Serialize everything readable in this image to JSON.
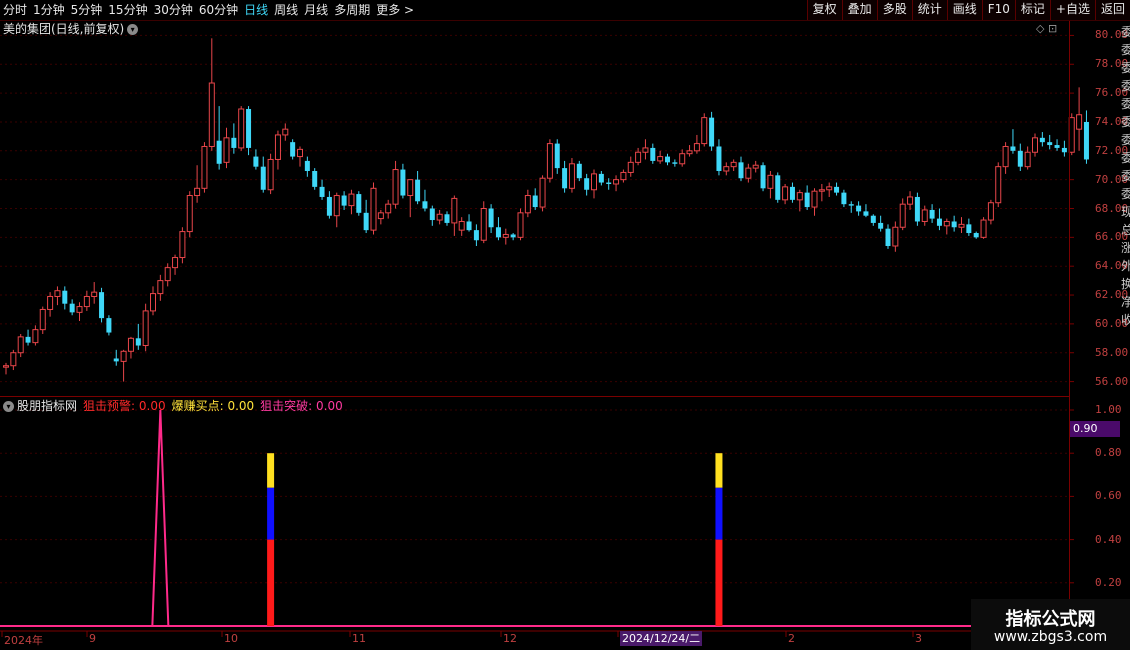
{
  "toolbar": {
    "periods": [
      "分时",
      "1分钟",
      "5分钟",
      "15分钟",
      "30分钟",
      "60分钟",
      "日线",
      "周线",
      "月线",
      "多周期",
      "更多 >"
    ],
    "active_period": "日线",
    "tools": [
      "复权",
      "叠加",
      "多股",
      "统计",
      "画线",
      "F10",
      "标记",
      "+自选",
      "返回"
    ]
  },
  "stock_title": "美的集团(日线,前复权)",
  "corner_icons": "◇ ⊡",
  "price_axis": [
    "80.00",
    "78.00",
    "76.00",
    "74.00",
    "72.00",
    "70.00",
    "68.00",
    "66.00",
    "64.00",
    "62.00",
    "60.00",
    "58.00",
    "56.00"
  ],
  "indicator": {
    "name": "股朋指标网",
    "items": [
      {
        "label": "狙击预警: 0.00",
        "color": "#ff2a2a"
      },
      {
        "label": "爆赚买点: 0.00",
        "color": "#ffe23a"
      },
      {
        "label": "狙击突破: 0.00",
        "color": "#ff3aa0"
      }
    ],
    "axis": [
      "1.00",
      "0.80",
      "0.60",
      "0.40",
      "0.20"
    ],
    "current_value": "0.90"
  },
  "date_labels": [
    "2024年",
    "9",
    "10",
    "11",
    "12",
    "2024/12/24/二",
    "2",
    "3"
  ],
  "right_strip_chars": [
    "委",
    "委",
    "委",
    "委",
    "委",
    "委",
    "委",
    "委",
    "委",
    "委",
    "现",
    "总",
    "涨",
    "外",
    "换",
    "净",
    "收"
  ],
  "watermark": {
    "line1": "指标公式网",
    "line2": "www.zbgs3.com"
  },
  "colors": {
    "up": "#e8464a",
    "down": "#3fd8f8",
    "pink": "#ff2a8a",
    "red_bar": "#ff1a1a",
    "blue_bar": "#1010ff",
    "yellow_bar": "#ffe020"
  },
  "chart_data": {
    "type": "candlestick",
    "ylim": [
      55,
      81
    ],
    "candles": [
      [
        57.0,
        57.3,
        56.5,
        57.1
      ],
      [
        57.1,
        58.2,
        56.8,
        58.0
      ],
      [
        58.0,
        59.3,
        57.7,
        59.1
      ],
      [
        59.1,
        59.6,
        58.5,
        58.7
      ],
      [
        58.7,
        59.9,
        58.5,
        59.6
      ],
      [
        59.6,
        61.2,
        59.3,
        61.0
      ],
      [
        61.0,
        62.2,
        60.5,
        61.9
      ],
      [
        61.9,
        62.6,
        61.3,
        62.3
      ],
      [
        62.3,
        62.6,
        61.0,
        61.4
      ],
      [
        61.4,
        61.7,
        60.6,
        60.8
      ],
      [
        60.8,
        61.5,
        60.2,
        61.2
      ],
      [
        61.2,
        62.3,
        60.9,
        61.9
      ],
      [
        61.9,
        62.9,
        61.4,
        62.2
      ],
      [
        62.2,
        62.5,
        60.1,
        60.4
      ],
      [
        60.4,
        60.6,
        59.2,
        59.4
      ],
      [
        57.6,
        58.2,
        57.1,
        57.4
      ],
      [
        57.4,
        58.2,
        56.0,
        58.1
      ],
      [
        58.1,
        59.1,
        57.6,
        59.0
      ],
      [
        59.0,
        60.0,
        58.2,
        58.5
      ],
      [
        58.5,
        61.4,
        58.1,
        60.9
      ],
      [
        60.9,
        62.6,
        60.6,
        62.1
      ],
      [
        62.1,
        63.4,
        61.6,
        63.0
      ],
      [
        63.0,
        64.2,
        62.6,
        63.9
      ],
      [
        63.9,
        64.8,
        63.4,
        64.6
      ],
      [
        64.6,
        66.7,
        64.2,
        66.4
      ],
      [
        66.4,
        69.2,
        66.0,
        68.9
      ],
      [
        68.9,
        71.0,
        68.4,
        69.4
      ],
      [
        69.4,
        72.6,
        69.1,
        72.3
      ],
      [
        72.3,
        79.8,
        72.0,
        76.7
      ],
      [
        72.7,
        75.1,
        70.7,
        71.1
      ],
      [
        71.2,
        73.6,
        70.8,
        72.9
      ],
      [
        72.9,
        73.9,
        71.8,
        72.2
      ],
      [
        72.2,
        75.1,
        72.0,
        74.9
      ],
      [
        74.9,
        75.1,
        71.7,
        72.2
      ],
      [
        71.6,
        72.1,
        70.7,
        70.9
      ],
      [
        70.9,
        71.6,
        69.1,
        69.3
      ],
      [
        69.3,
        71.8,
        69.0,
        71.4
      ],
      [
        71.4,
        73.4,
        70.7,
        73.1
      ],
      [
        73.1,
        73.9,
        72.7,
        73.5
      ],
      [
        72.6,
        72.8,
        71.4,
        71.6
      ],
      [
        71.6,
        72.3,
        70.9,
        72.1
      ],
      [
        71.3,
        71.6,
        70.2,
        70.6
      ],
      [
        70.6,
        70.8,
        69.3,
        69.5
      ],
      [
        69.5,
        70.0,
        68.6,
        68.8
      ],
      [
        68.8,
        69.2,
        67.3,
        67.5
      ],
      [
        67.5,
        69.1,
        66.7,
        68.9
      ],
      [
        68.9,
        69.2,
        67.9,
        68.2
      ],
      [
        68.2,
        69.3,
        67.6,
        69.0
      ],
      [
        69.0,
        69.2,
        67.5,
        67.7
      ],
      [
        67.7,
        68.6,
        66.3,
        66.5
      ],
      [
        66.5,
        69.8,
        66.2,
        69.4
      ],
      [
        67.3,
        67.9,
        66.9,
        67.7
      ],
      [
        67.7,
        68.6,
        67.3,
        68.3
      ],
      [
        68.3,
        71.3,
        68.0,
        70.7
      ],
      [
        70.7,
        71.1,
        68.7,
        68.9
      ],
      [
        68.9,
        69.9,
        67.4,
        70.0
      ],
      [
        70.0,
        70.6,
        68.3,
        68.5
      ],
      [
        68.5,
        69.3,
        67.8,
        68.0
      ],
      [
        68.0,
        68.2,
        66.8,
        67.2
      ],
      [
        67.2,
        67.9,
        66.9,
        67.6
      ],
      [
        67.6,
        67.8,
        66.8,
        67.0
      ],
      [
        67.0,
        68.9,
        66.1,
        68.7
      ],
      [
        66.5,
        67.4,
        66.1,
        67.1
      ],
      [
        67.1,
        67.6,
        66.4,
        66.5
      ],
      [
        66.5,
        66.9,
        65.4,
        65.8
      ],
      [
        65.8,
        68.5,
        65.6,
        68.0
      ],
      [
        68.0,
        68.3,
        66.3,
        66.7
      ],
      [
        66.7,
        67.4,
        65.8,
        66.0
      ],
      [
        66.0,
        66.6,
        65.5,
        66.2
      ],
      [
        66.2,
        66.3,
        65.8,
        66.0
      ],
      [
        66.0,
        68.0,
        65.8,
        67.7
      ],
      [
        67.7,
        69.3,
        67.4,
        68.9
      ],
      [
        68.9,
        69.4,
        67.9,
        68.1
      ],
      [
        68.1,
        70.3,
        67.8,
        70.1
      ],
      [
        70.1,
        72.8,
        69.8,
        72.5
      ],
      [
        72.5,
        72.8,
        70.4,
        70.8
      ],
      [
        70.8,
        71.3,
        69.1,
        69.4
      ],
      [
        69.4,
        71.5,
        69.1,
        71.1
      ],
      [
        71.1,
        71.3,
        69.9,
        70.1
      ],
      [
        70.1,
        70.4,
        68.9,
        69.3
      ],
      [
        69.3,
        70.7,
        68.7,
        70.4
      ],
      [
        70.4,
        70.6,
        69.6,
        69.8
      ],
      [
        69.8,
        70.1,
        69.3,
        69.7
      ],
      [
        69.7,
        70.3,
        69.2,
        70.0
      ],
      [
        70.0,
        70.7,
        69.8,
        70.5
      ],
      [
        70.5,
        71.6,
        70.2,
        71.2
      ],
      [
        71.2,
        72.2,
        71.0,
        71.9
      ],
      [
        71.9,
        72.8,
        71.4,
        72.2
      ],
      [
        72.2,
        72.5,
        71.1,
        71.3
      ],
      [
        71.3,
        72.0,
        71.1,
        71.6
      ],
      [
        71.6,
        71.8,
        71.0,
        71.2
      ],
      [
        71.2,
        71.4,
        70.9,
        71.1
      ],
      [
        71.1,
        72.1,
        70.9,
        71.8
      ],
      [
        71.8,
        72.4,
        71.6,
        72.0
      ],
      [
        72.0,
        73.1,
        71.8,
        72.5
      ],
      [
        72.5,
        74.6,
        72.3,
        74.3
      ],
      [
        74.3,
        74.7,
        72.0,
        72.3
      ],
      [
        72.3,
        72.8,
        70.3,
        70.6
      ],
      [
        70.6,
        71.2,
        70.3,
        70.9
      ],
      [
        70.9,
        71.4,
        70.6,
        71.2
      ],
      [
        71.2,
        71.6,
        69.9,
        70.1
      ],
      [
        70.1,
        71.1,
        69.8,
        70.8
      ],
      [
        70.8,
        71.3,
        70.5,
        71.0
      ],
      [
        71.0,
        71.2,
        69.2,
        69.4
      ],
      [
        69.4,
        70.6,
        68.7,
        70.3
      ],
      [
        70.3,
        70.5,
        68.4,
        68.6
      ],
      [
        68.6,
        69.7,
        68.3,
        69.5
      ],
      [
        69.5,
        69.8,
        68.4,
        68.6
      ],
      [
        68.6,
        69.3,
        67.8,
        69.1
      ],
      [
        69.1,
        69.6,
        67.9,
        68.1
      ],
      [
        68.1,
        69.4,
        67.5,
        69.2
      ],
      [
        69.2,
        69.7,
        68.5,
        69.3
      ],
      [
        69.3,
        69.8,
        68.8,
        69.5
      ],
      [
        69.5,
        69.8,
        68.9,
        69.1
      ],
      [
        69.1,
        69.3,
        68.1,
        68.3
      ],
      [
        68.3,
        68.5,
        67.7,
        68.2
      ],
      [
        68.2,
        68.5,
        67.5,
        67.8
      ],
      [
        67.8,
        68.3,
        67.4,
        67.5
      ],
      [
        67.5,
        67.6,
        66.8,
        67.0
      ],
      [
        67.0,
        67.5,
        66.4,
        66.6
      ],
      [
        66.6,
        66.9,
        65.2,
        65.4
      ],
      [
        65.4,
        67.1,
        65.0,
        66.7
      ],
      [
        66.7,
        68.7,
        66.5,
        68.3
      ],
      [
        68.3,
        69.2,
        67.9,
        68.8
      ],
      [
        68.8,
        69.1,
        66.8,
        67.1
      ],
      [
        67.1,
        68.2,
        66.8,
        67.9
      ],
      [
        67.9,
        68.3,
        67.0,
        67.3
      ],
      [
        67.3,
        68.0,
        66.5,
        66.8
      ],
      [
        66.8,
        67.3,
        66.2,
        67.1
      ],
      [
        67.1,
        67.5,
        66.4,
        66.7
      ],
      [
        66.7,
        67.4,
        66.3,
        66.9
      ],
      [
        66.9,
        67.3,
        66.1,
        66.3
      ],
      [
        66.3,
        66.4,
        65.9,
        66.0
      ],
      [
        66.0,
        67.4,
        65.9,
        67.2
      ],
      [
        67.2,
        68.6,
        66.9,
        68.4
      ],
      [
        68.4,
        71.2,
        68.1,
        70.9
      ],
      [
        70.9,
        72.6,
        70.4,
        72.3
      ],
      [
        72.3,
        73.5,
        71.8,
        72.0
      ],
      [
        72.0,
        72.5,
        70.6,
        70.9
      ],
      [
        70.9,
        72.3,
        70.7,
        71.9
      ],
      [
        71.9,
        73.2,
        71.6,
        72.9
      ],
      [
        72.9,
        73.3,
        72.3,
        72.6
      ],
      [
        72.6,
        73.1,
        72.1,
        72.4
      ],
      [
        72.4,
        72.8,
        72.0,
        72.2
      ],
      [
        72.2,
        72.7,
        71.6,
        71.9
      ],
      [
        71.9,
        74.6,
        71.7,
        74.3
      ],
      [
        73.5,
        76.4,
        72.0,
        74.5
      ],
      [
        74.0,
        74.8,
        71.1,
        71.4
      ]
    ],
    "signals": [
      {
        "index": 21,
        "kind": "spike",
        "value": 1.0
      },
      {
        "index": 36,
        "kind": "stack",
        "red": 0.4,
        "blue": 0.64,
        "yellow": 0.8
      },
      {
        "index": 97,
        "kind": "stack",
        "red": 0.4,
        "blue": 0.64,
        "yellow": 0.8
      }
    ],
    "indicator_ylim": [
      0,
      1.0
    ]
  }
}
